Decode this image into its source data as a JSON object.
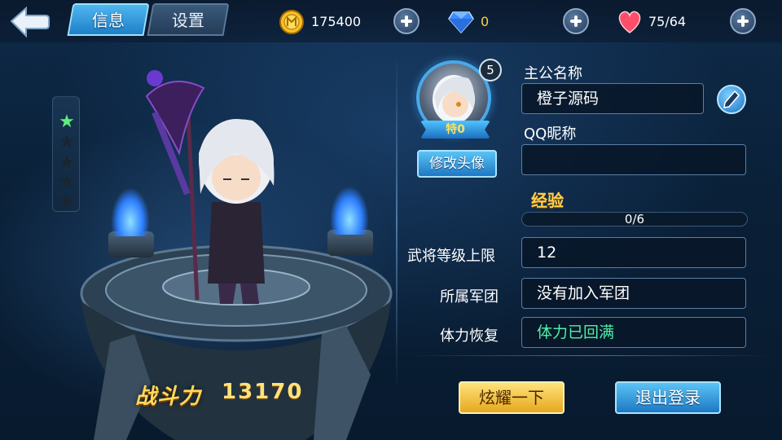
{
  "tabs": {
    "info": "信息",
    "settings": "设置"
  },
  "resources": {
    "gold": {
      "icon": "gold-coin-icon",
      "value": "175400"
    },
    "diamond": {
      "icon": "diamond-icon",
      "value": "0"
    },
    "stamina": {
      "icon": "heart-icon",
      "value": "75/64"
    }
  },
  "hero": {
    "star_count_filled": 1,
    "star_count_total": 5,
    "power_label": "战斗力",
    "power_value": "13170"
  },
  "profile": {
    "level": "5",
    "vip_label": "特0",
    "change_avatar_label": "修改头像",
    "lord_name_label": "主公名称",
    "lord_name_value": "橙子源码",
    "qq_nickname_label": "QQ昵称",
    "qq_nickname_value": "",
    "exp_label": "经验",
    "exp_text": "0/6",
    "exp_progress": 0,
    "general_level_cap_label": "武将等级上限",
    "general_level_cap_value": "12",
    "legion_label": "所属军团",
    "legion_value": "没有加入军团",
    "stamina_recovery_label": "体力恢复",
    "stamina_recovery_value": "体力已回满"
  },
  "buttons": {
    "show_off": "炫耀一下",
    "logout": "退出登录"
  },
  "colors": {
    "accent_blue": "#1e7fc8",
    "gold": "#ffd04a",
    "recovery_green": "#4ff0a8"
  }
}
